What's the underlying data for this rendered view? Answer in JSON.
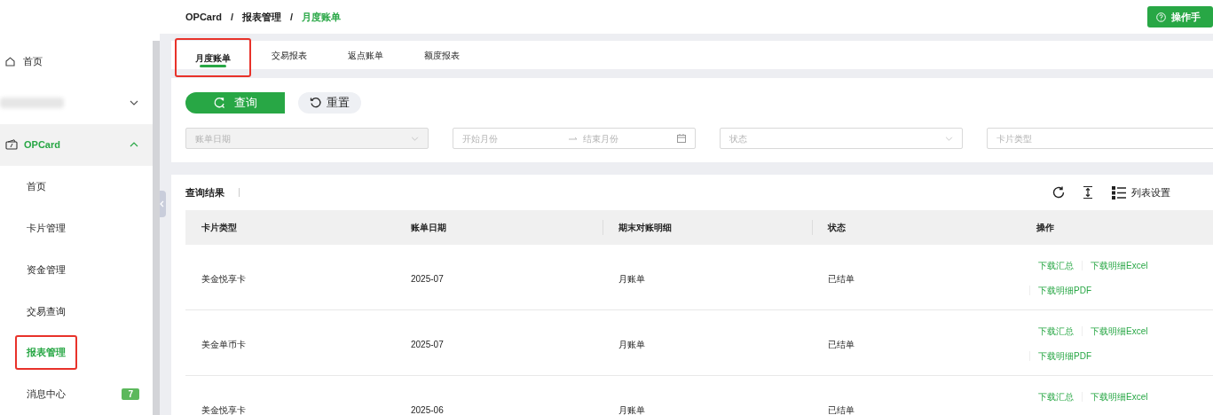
{
  "sidebar": {
    "items": [
      {
        "kind": "link",
        "label": "首页",
        "selected": false
      },
      {
        "kind": "blurred",
        "expanded": false
      },
      {
        "kind": "group",
        "label": "OPCard",
        "expanded": true,
        "selected": true,
        "children": [
          {
            "label": "首页",
            "selected": false,
            "highlighted": false
          },
          {
            "label": "卡片管理",
            "selected": false,
            "highlighted": false
          },
          {
            "label": "资金管理",
            "selected": false,
            "highlighted": false
          },
          {
            "label": "交易查询",
            "selected": false,
            "highlighted": false
          },
          {
            "label": "报表管理",
            "selected": true,
            "highlighted": true
          },
          {
            "label": "消息中心",
            "selected": false,
            "highlighted": false,
            "badge": "7"
          }
        ]
      }
    ]
  },
  "breadcrumb": {
    "items": [
      "OPCard",
      "报表管理",
      "月度账单"
    ],
    "separator": "/"
  },
  "help_button": "操作手",
  "tabs": [
    {
      "label": "月度账单",
      "selected": true,
      "highlighted": true
    },
    {
      "label": "交易报表",
      "selected": false,
      "highlighted": false
    },
    {
      "label": "返点账单",
      "selected": false,
      "highlighted": false
    },
    {
      "label": "额度报表",
      "selected": false,
      "highlighted": false
    }
  ],
  "buttons": {
    "query": "查询",
    "reset": "重置"
  },
  "filters": [
    {
      "kind": "select",
      "placeholder": "账单日期",
      "disabled": true
    },
    {
      "kind": "range",
      "start": "开始月份",
      "end": "结束月份"
    },
    {
      "kind": "select",
      "placeholder": "状态",
      "disabled": false
    },
    {
      "kind": "text",
      "placeholder": "卡片类型"
    }
  ],
  "results": {
    "title": "查询结果",
    "settings": "列表设置"
  },
  "table": {
    "columns": [
      "卡片类型",
      "账单日期",
      "期末对账明细",
      "状态",
      "操作"
    ],
    "rows": [
      {
        "cells": [
          "美金悦享卡",
          "2025-07",
          "月账单",
          "已结单"
        ],
        "actions": [
          "下载汇总",
          "下载明细Excel",
          "下载明细PDF"
        ]
      },
      {
        "cells": [
          "美金单币卡",
          "2025-07",
          "月账单",
          "已结单"
        ],
        "actions": [
          "下载汇总",
          "下载明细Excel",
          "下载明细PDF"
        ]
      },
      {
        "cells": [
          "美金悦享卡",
          "2025-06",
          "月账单",
          "已结单"
        ],
        "actions": [
          "下载汇总",
          "下载明细Excel"
        ]
      }
    ]
  }
}
